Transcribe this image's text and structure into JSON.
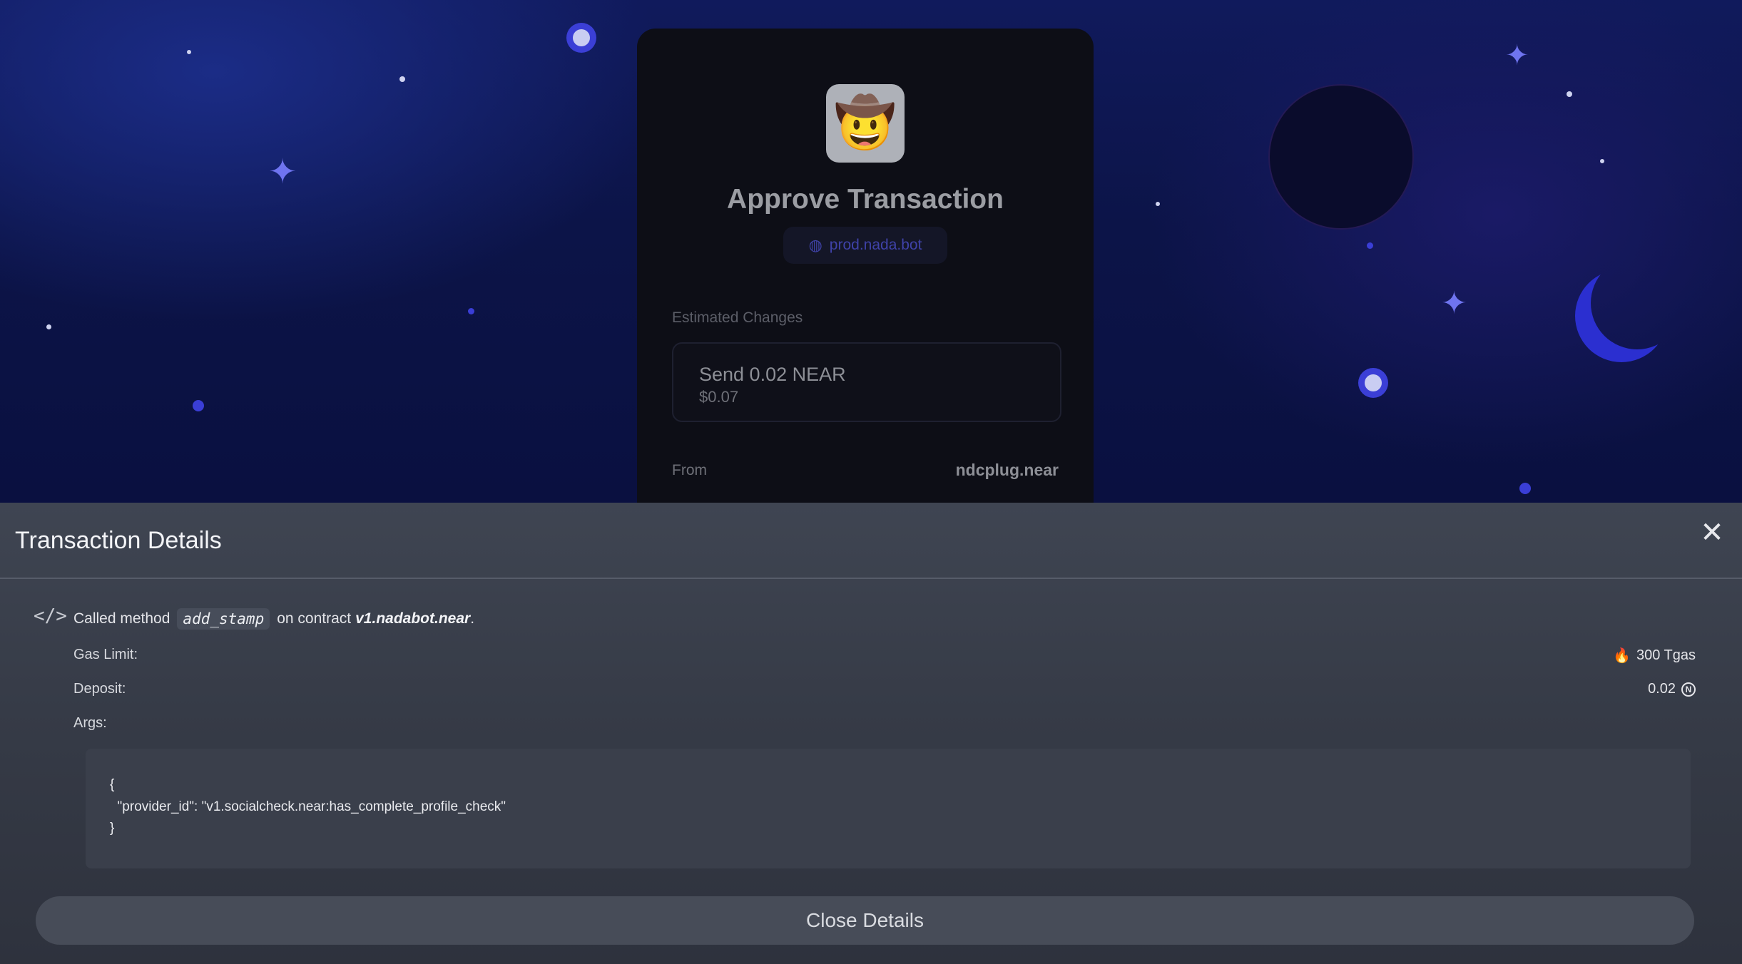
{
  "approval": {
    "title": "Approve Transaction",
    "origin": "prod.nada.bot",
    "estimated_changes_label": "Estimated Changes",
    "send_amount": "Send 0.02 NEAR",
    "send_usd": "$0.07",
    "from_label": "From",
    "from_value": "ndcplug.near",
    "app_icon_glyph": "🤠"
  },
  "details": {
    "title": "Transaction Details",
    "close_glyph": "✕",
    "code_icon_glyph": "</>",
    "called_method_prefix": "Called method",
    "method": "add_stamp",
    "on_contract_text": "on contract",
    "contract": "v1.nadabot.near",
    "period": ".",
    "gas_limit_label": "Gas Limit:",
    "gas_limit_value": "300 Tgas",
    "gas_icon_glyph": "🔥",
    "deposit_label": "Deposit:",
    "deposit_value": "0.02",
    "near_symbol_glyph": "N",
    "args_label": "Args:",
    "args_lines": [
      "{",
      "  \"provider_id\": \"v1.socialcheck.near:has_complete_profile_check\"",
      "}"
    ],
    "close_button_label": "Close Details"
  },
  "colors": {
    "sheet_bg": "#3f4552",
    "accent_blue": "#3a3ed6",
    "card_bg": "#0d0e16"
  }
}
